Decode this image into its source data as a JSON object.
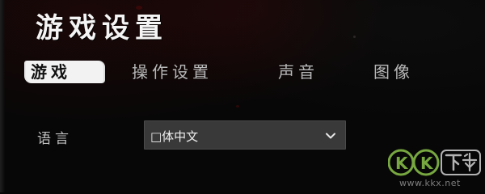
{
  "title": "游戏设置",
  "tabs": [
    {
      "label": "游戏",
      "active": true
    },
    {
      "label": "操作设置",
      "active": false
    },
    {
      "label": "声音",
      "active": false
    },
    {
      "label": "图像",
      "active": false
    }
  ],
  "settings": {
    "language": {
      "label": "语言",
      "value": "□体中文"
    }
  },
  "watermark": {
    "logo_text": "KK下载",
    "url": "www.kkx.net"
  },
  "colors": {
    "background": "#070707",
    "text": "#f4f4f4",
    "tab_text": "#b8b8b8",
    "active_tab_bg": "#f2f2f2",
    "select_bg": "#393939",
    "watermark_green": "#8bc34a"
  },
  "icons": {
    "dropdown": "chevron-down-icon",
    "watermark_logo": "kk-logo-icon"
  }
}
